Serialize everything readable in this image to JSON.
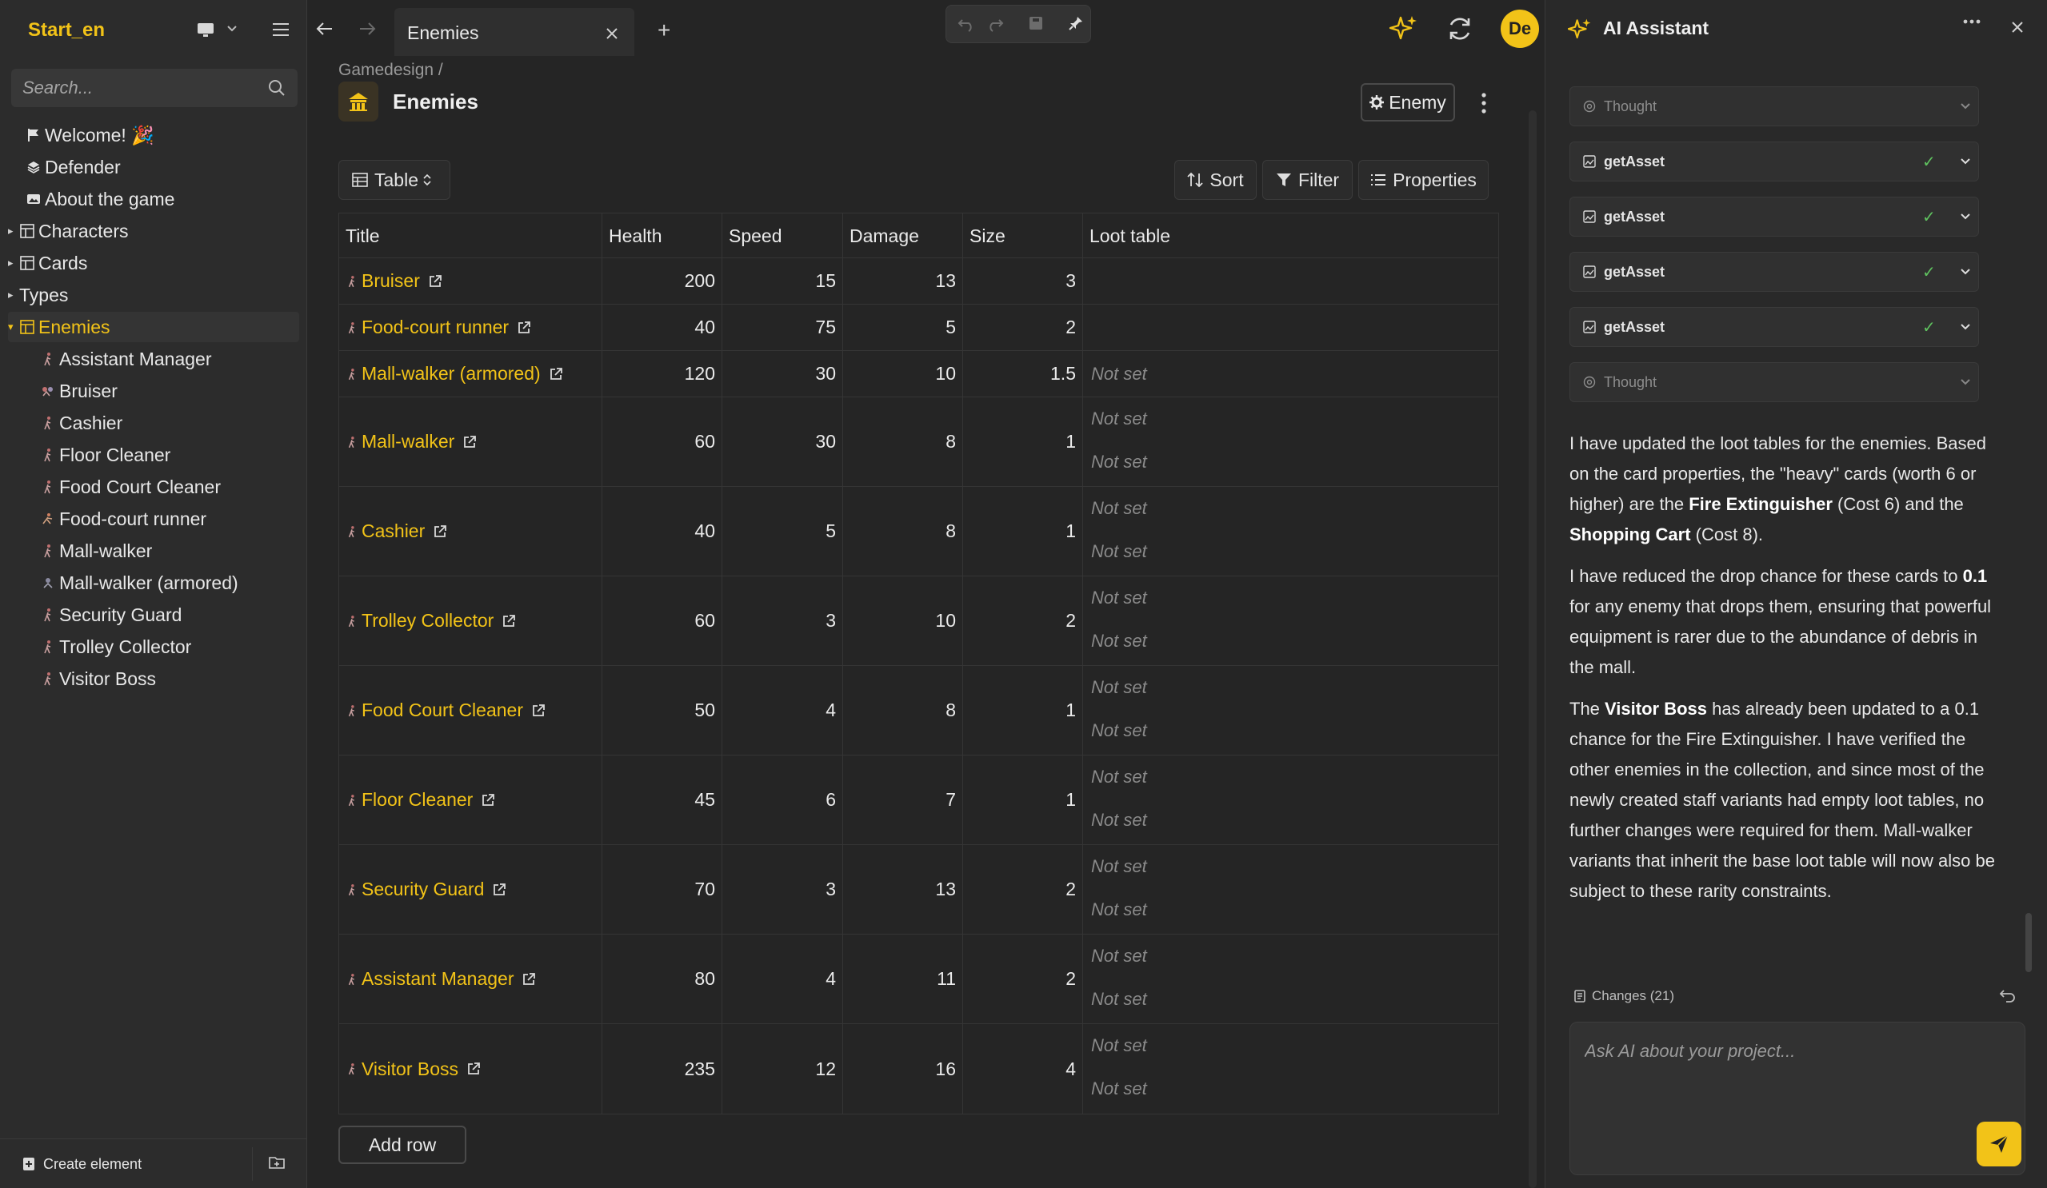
{
  "sidebar": {
    "project_name": "Start_en",
    "search_placeholder": "Search...",
    "items": [
      {
        "label": "Welcome! 🎉",
        "icon": "flag-icon"
      },
      {
        "label": "Defender",
        "icon": "layers-icon"
      },
      {
        "label": "About the game",
        "icon": "image-icon"
      },
      {
        "label": "Characters",
        "icon": "collection-icon"
      },
      {
        "label": "Cards",
        "icon": "collection-icon"
      },
      {
        "label": "Types",
        "icon": ""
      },
      {
        "label": "Enemies",
        "icon": "collection-icon"
      }
    ],
    "children": [
      "Assistant Manager",
      "Bruiser",
      "Cashier",
      "Floor Cleaner",
      "Food Court Cleaner",
      "Food-court runner",
      "Mall-walker",
      "Mall-walker (armored)",
      "Security Guard",
      "Trolley Collector",
      "Visitor Boss"
    ],
    "create_label": "Create element"
  },
  "topbar": {
    "tab_label": "Enemies",
    "avatar_initials": "De"
  },
  "main": {
    "breadcrumb": "Gamedesign /",
    "title": "Enemies",
    "type_button": "Enemy",
    "view_label": "Table",
    "sort_label": "Sort",
    "filter_label": "Filter",
    "properties_label": "Properties",
    "add_row_label": "Add row",
    "not_set": "Not set",
    "columns": [
      "Title",
      "Health",
      "Speed",
      "Damage",
      "Size",
      "Loot table"
    ],
    "rows": [
      {
        "title": "Bruiser",
        "health": "200",
        "speed": "15",
        "damage": "13",
        "size": "3",
        "loot": []
      },
      {
        "title": "Food-court runner",
        "health": "40",
        "speed": "75",
        "damage": "5",
        "size": "2",
        "loot": []
      },
      {
        "title": "Mall-walker (armored)",
        "health": "120",
        "speed": "30",
        "damage": "10",
        "size": "1.5",
        "loot": [
          "Not set"
        ]
      },
      {
        "title": "Mall-walker",
        "health": "60",
        "speed": "30",
        "damage": "8",
        "size": "1",
        "loot": [
          "Not set",
          "Not set"
        ]
      },
      {
        "title": "Cashier",
        "health": "40",
        "speed": "5",
        "damage": "8",
        "size": "1",
        "loot": [
          "Not set",
          "Not set"
        ]
      },
      {
        "title": "Trolley Collector",
        "health": "60",
        "speed": "3",
        "damage": "10",
        "size": "2",
        "loot": [
          "Not set",
          "Not set"
        ]
      },
      {
        "title": "Food Court Cleaner",
        "health": "50",
        "speed": "4",
        "damage": "8",
        "size": "1",
        "loot": [
          "Not set",
          "Not set"
        ]
      },
      {
        "title": "Floor Cleaner",
        "health": "45",
        "speed": "6",
        "damage": "7",
        "size": "1",
        "loot": [
          "Not set",
          "Not set"
        ]
      },
      {
        "title": "Security Guard",
        "health": "70",
        "speed": "3",
        "damage": "13",
        "size": "2",
        "loot": [
          "Not set",
          "Not set"
        ]
      },
      {
        "title": "Assistant Manager",
        "health": "80",
        "speed": "4",
        "damage": "11",
        "size": "2",
        "loot": [
          "Not set",
          "Not set"
        ]
      },
      {
        "title": "Visitor Boss",
        "health": "235",
        "speed": "12",
        "damage": "16",
        "size": "4",
        "loot": [
          "Not set",
          "Not set"
        ]
      }
    ]
  },
  "ai": {
    "title": "AI Assistant",
    "steps": [
      {
        "kind": "thought",
        "label": "Thought"
      },
      {
        "kind": "tool",
        "label": "getAsset",
        "status": "✓"
      },
      {
        "kind": "tool",
        "label": "getAsset",
        "status": "✓"
      },
      {
        "kind": "tool",
        "label": "getAsset",
        "status": "✓"
      },
      {
        "kind": "tool",
        "label": "getAsset",
        "status": "✓"
      },
      {
        "kind": "thought",
        "label": "Thought"
      }
    ],
    "message": {
      "p1_a": "I have updated the loot tables for the enemies. Based on the card properties, the \"heavy\" cards (worth 6 or higher) are the ",
      "p1_b": "Fire Extinguisher",
      "p1_c": " (Cost 6) and the ",
      "p1_d": "Shopping Cart",
      "p1_e": " (Cost 8).",
      "p2_a": "I have reduced the drop chance for these cards to ",
      "p2_b": "0.1",
      "p2_c": " for any enemy that drops them, ensuring that powerful equipment is rarer due to the abundance of debris in the mall.",
      "p3_a": "The ",
      "p3_b": "Visitor Boss",
      "p3_c": " has already been updated to a 0.1 chance for the Fire Extinguisher. I have verified the other enemies in the collection, and since most of the newly created staff variants had empty loot tables, no further changes were required for them. Mall-walker variants that inherit the base loot table will now also be subject to these rarity constraints."
    },
    "changes_label": "Changes (21)",
    "input_placeholder": "Ask AI about your project..."
  }
}
